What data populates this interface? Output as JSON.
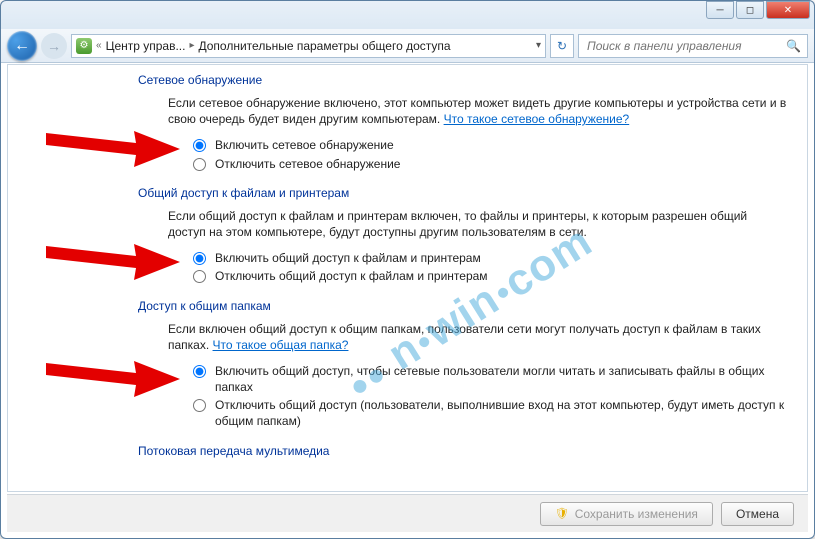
{
  "titlebar": {},
  "nav": {
    "breadcrumb1": "Центр управ...",
    "breadcrumb2": "Дополнительные параметры общего доступа"
  },
  "search": {
    "placeholder": "Поиск в панели управления"
  },
  "sections": {
    "netdisc": {
      "title": "Сетевое обнаружение",
      "desc": "Если сетевое обнаружение включено, этот компьютер может видеть другие компьютеры и устройства сети и в свою очередь будет виден другим компьютерам. ",
      "link": "Что такое сетевое обнаружение?",
      "opt_on": "Включить сетевое обнаружение",
      "opt_off": "Отключить сетевое обнаружение"
    },
    "fileshare": {
      "title": "Общий доступ к файлам и принтерам",
      "desc": "Если общий доступ к файлам и принтерам включен, то файлы и принтеры, к которым разрешен общий доступ на этом компьютере, будут доступны другим пользователям в сети.",
      "opt_on": "Включить общий доступ к файлам и принтерам",
      "opt_off": "Отключить общий доступ к файлам и принтерам"
    },
    "pubfolder": {
      "title": "Доступ к общим папкам",
      "desc": "Если включен общий доступ к общим папкам, пользователи сети могут получать доступ к файлам в таких папках. ",
      "link": "Что такое общая папка?",
      "opt_on": "Включить общий доступ, чтобы сетевые пользователи могли читать и записывать файлы в общих папках",
      "opt_off": "Отключить общий доступ (пользователи, выполнившие вход на этот компьютер, будут иметь доступ к общим папкам)"
    },
    "media": {
      "title": "Потоковая передача мультимедиа"
    }
  },
  "buttons": {
    "save": "Сохранить изменения",
    "cancel": "Отмена"
  },
  "watermark": "nowin com"
}
